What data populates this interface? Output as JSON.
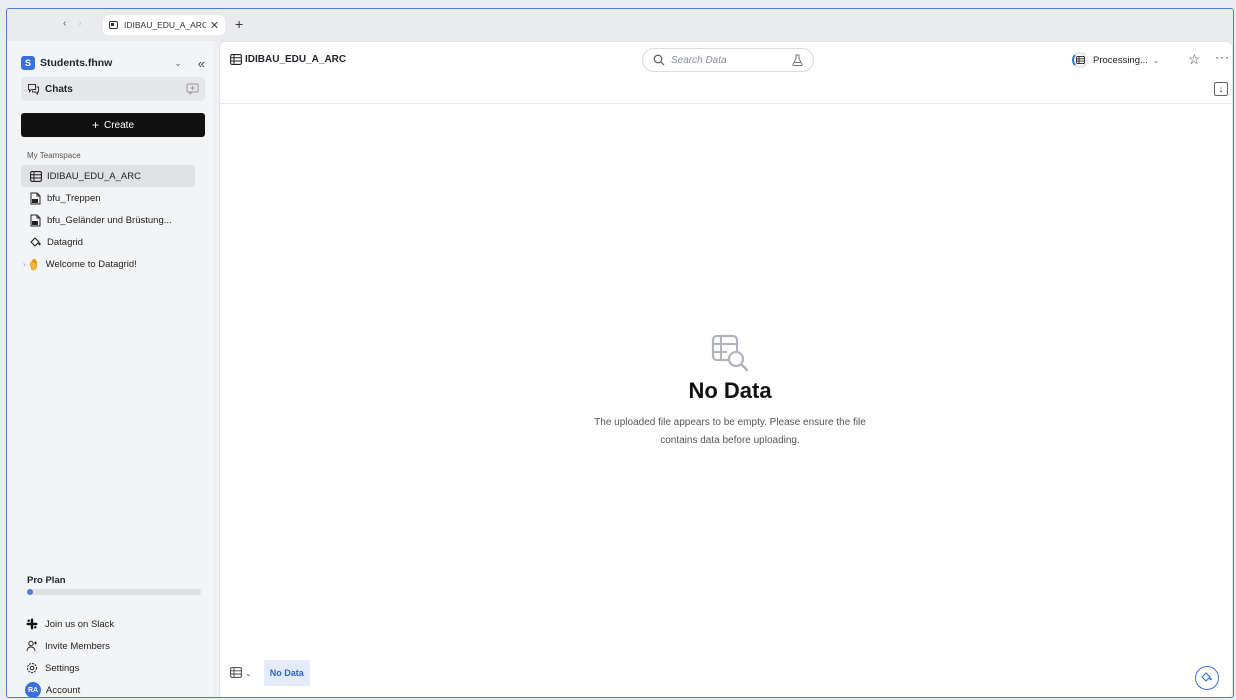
{
  "browser": {
    "tab_title": "IDIBAU_EDU_A_ARC",
    "close_glyph": "✕",
    "new_tab_glyph": "+",
    "back_glyph": "‹",
    "forward_glyph": "›"
  },
  "sidebar": {
    "workspace": {
      "badge": "S",
      "name": "Students.fhnw"
    },
    "chats_label": "Chats",
    "create_label": "Create",
    "section_label": "My Teamspace",
    "items": [
      {
        "label": "IDIBAU_EDU_A_ARC",
        "icon": "table-icon",
        "active": true
      },
      {
        "label": "bfu_Treppen",
        "icon": "pdf-icon"
      },
      {
        "label": "bfu_Geländer und Brüstung...",
        "icon": "pdf-icon"
      },
      {
        "label": "Datagrid",
        "icon": "datagrid-logo-icon"
      },
      {
        "label": "Welcome to Datagrid!",
        "icon": "wave-hand-icon",
        "expandable": true
      }
    ],
    "plan": {
      "label": "Pro Plan",
      "usage_fraction": 0.03
    },
    "footer": {
      "slack": "Join us on Slack",
      "invite": "Invite Members",
      "settings": "Settings",
      "account": "Account",
      "account_initials": "RA"
    }
  },
  "header": {
    "title": "IDIBAU_EDU_A_ARC",
    "search_placeholder": "Search Data",
    "status": "Processing...",
    "more_glyph": "···"
  },
  "empty_state": {
    "title": "No Data",
    "message_line1": "The uploaded file appears to be empty. Please ensure the file",
    "message_line2": "contains data before uploading."
  },
  "bottom": {
    "sheet_tab": "No Data"
  },
  "colors": {
    "accent": "#3b6fe0",
    "create_button": "#111111",
    "active_tab_bg": "#e4ecfb"
  }
}
